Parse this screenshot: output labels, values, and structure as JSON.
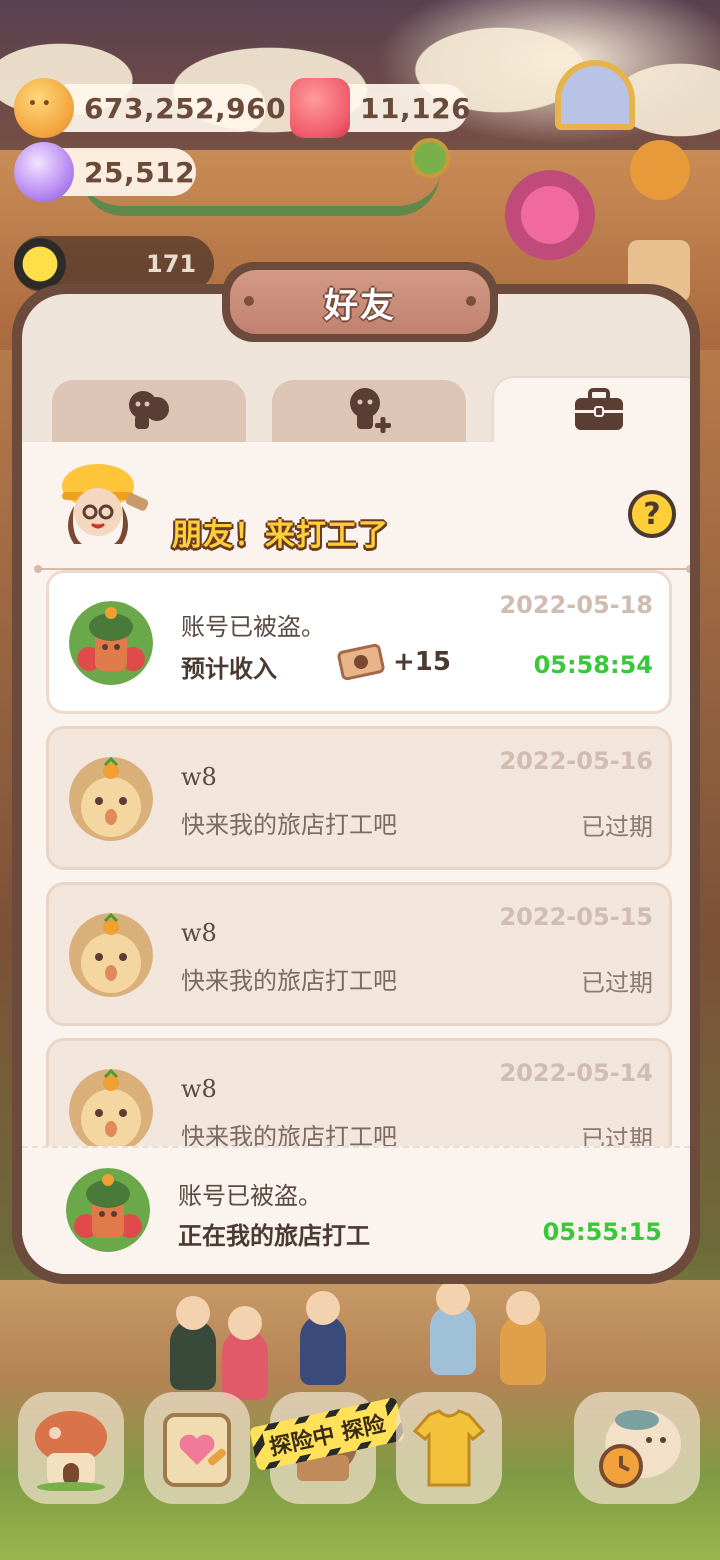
{
  "resources": {
    "coins": "673,252,960",
    "candles": "11,126",
    "gems": "25,512",
    "hud_counter": "171"
  },
  "dialog": {
    "title": "好友",
    "tabs": [
      {
        "icon": "friends-icon",
        "active": false
      },
      {
        "icon": "add-friend-icon",
        "active": false
      },
      {
        "icon": "briefcase-icon",
        "active": true
      }
    ],
    "banner": {
      "text": "朋友！来打工了",
      "help_label": "?"
    },
    "requests": [
      {
        "name": "账号已被盗。",
        "message": "预计收入",
        "reward_icon": "ticket-icon",
        "reward": "+15",
        "date": "2022-05-18",
        "status": "05:58:54",
        "status_color": "#3ac83a",
        "current": true
      },
      {
        "name": "w8",
        "message": "快来我的旅店打工吧",
        "date": "2022-05-16",
        "status": "已过期"
      },
      {
        "name": "w8",
        "message": "快来我的旅店打工吧",
        "date": "2022-05-15",
        "status": "已过期"
      },
      {
        "name": "w8",
        "message": "快来我的旅店打工吧",
        "date": "2022-05-14",
        "status": "已过期"
      }
    ],
    "footer": {
      "name": "账号已被盗。",
      "message": "正在我的旅店打工",
      "timer": "05:55:15"
    }
  },
  "bottom_nav": {
    "tape_text": "探险中 探险",
    "buttons": [
      "house-icon",
      "diary-icon",
      "explore-icon",
      "clothes-icon",
      "fish-clock-icon"
    ]
  },
  "colors": {
    "frame": "#6c4a3c",
    "panel": "#faf3ee",
    "timer_green": "#3ac83a",
    "banner_yellow": "#ffcf3a"
  }
}
